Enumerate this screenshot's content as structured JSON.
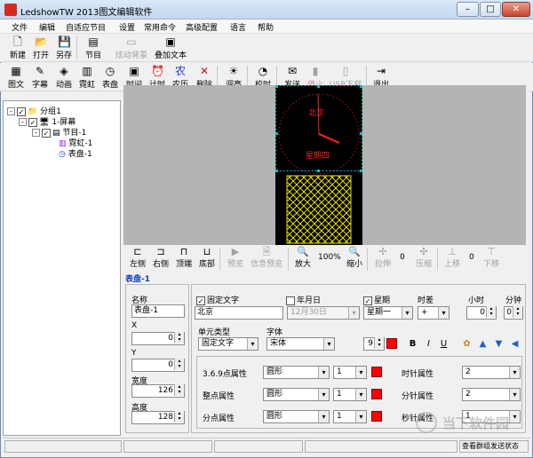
{
  "window": {
    "title": "LedshowTW 2013图文编辑软件",
    "controls": [
      "–",
      "□",
      "✕"
    ]
  },
  "menu": [
    "文件",
    "编辑",
    "自适应节目",
    "设置",
    "常用命令",
    "高级配置",
    "语言",
    "帮助"
  ],
  "toolbar1": [
    {
      "label": "新建",
      "icon": "new-file-icon",
      "glyph": "🗋",
      "enabled": true
    },
    {
      "label": "打开",
      "icon": "open-folder-icon",
      "glyph": "📂",
      "enabled": true
    },
    {
      "label": "另存",
      "icon": "save-icon",
      "glyph": "💾",
      "enabled": true
    },
    {
      "label": "节目",
      "icon": "program-icon",
      "glyph": "▤",
      "enabled": true
    },
    {
      "label": "炫动背景",
      "icon": "dynamic-background-icon",
      "glyph": "▭",
      "enabled": false
    },
    {
      "label": "叠加文本",
      "icon": "overlay-text-icon",
      "glyph": "▣",
      "enabled": true
    }
  ],
  "toolbar2": [
    {
      "label": "图文",
      "icon": "image-text-icon",
      "glyph": "▦",
      "enabled": true
    },
    {
      "label": "字幕",
      "icon": "subtitle-icon",
      "glyph": "✎",
      "enabled": true
    },
    {
      "label": "动画",
      "icon": "animation-icon",
      "glyph": "◈",
      "enabled": true
    },
    {
      "label": "霓虹",
      "icon": "neon-icon",
      "glyph": "▥",
      "enabled": true
    },
    {
      "label": "表盘",
      "icon": "clock-dial-icon",
      "glyph": "◷",
      "enabled": true
    },
    {
      "label": "时间",
      "icon": "time-icon",
      "glyph": "▣",
      "enabled": true
    },
    {
      "label": "计时",
      "icon": "timer-icon",
      "glyph": "⏰",
      "enabled": true
    },
    {
      "label": "农历",
      "icon": "lunar-calendar-icon",
      "glyph": "农",
      "enabled": true
    },
    {
      "label": "删除",
      "icon": "delete-icon",
      "glyph": "✕",
      "enabled": true
    },
    {
      "label": "调亮",
      "icon": "brightness-icon",
      "glyph": "☀",
      "enabled": true
    },
    {
      "label": "校时",
      "icon": "sync-time-icon",
      "glyph": "◔",
      "enabled": true
    },
    {
      "label": "发送",
      "icon": "send-icon",
      "glyph": "✉",
      "enabled": true
    },
    {
      "label": "停止",
      "icon": "stop-icon",
      "glyph": "▮",
      "enabled": false
    },
    {
      "label": "USB下载",
      "icon": "usb-download-icon",
      "glyph": "▯",
      "enabled": false
    },
    {
      "label": "退出",
      "icon": "exit-icon",
      "glyph": "⇥",
      "enabled": true
    }
  ],
  "tree": [
    {
      "label": "分组1",
      "toggle": "-",
      "icon": "folder-icon",
      "glyph": "📁"
    },
    {
      "label": "1-屏幕",
      "toggle": "-",
      "icon": "monitor-icon",
      "glyph": "🖥"
    },
    {
      "label": "节目-1",
      "toggle": "-",
      "icon": "program-icon",
      "glyph": "▤"
    },
    {
      "label": "霓虹-1",
      "toggle": "",
      "icon": "neon-icon",
      "glyph": "▥"
    },
    {
      "label": "表盘-1",
      "toggle": "",
      "icon": "clock-dial-icon",
      "glyph": "◷"
    }
  ],
  "preview": {
    "city": "北京",
    "weekday": "星期四"
  },
  "bottom_toolbar": [
    {
      "label": "左侧",
      "icon": "align-left-icon",
      "glyph": "⊏",
      "enabled": true
    },
    {
      "label": "右侧",
      "icon": "align-right-icon",
      "glyph": "⊐",
      "enabled": true
    },
    {
      "label": "顶端",
      "icon": "align-top-icon",
      "glyph": "⊓",
      "enabled": true
    },
    {
      "label": "底部",
      "icon": "align-bottom-icon",
      "glyph": "⊔",
      "enabled": true
    },
    {
      "label": "预览",
      "icon": "preview-icon",
      "glyph": "▶",
      "enabled": false
    },
    {
      "label": "信息预览",
      "icon": "info-preview-icon",
      "glyph": "🗎",
      "enabled": false
    },
    {
      "label": "放大",
      "icon": "zoom-in-icon",
      "glyph": "🔍",
      "enabled": true
    },
    {
      "label": "缩小",
      "icon": "zoom-out-icon",
      "glyph": "🔍",
      "enabled": true
    },
    {
      "label": "拉伸",
      "icon": "stretch-icon",
      "glyph": "✢",
      "enabled": false
    },
    {
      "label": "压缩",
      "icon": "compress-icon",
      "glyph": "✣",
      "enabled": false
    },
    {
      "label": "上移",
      "icon": "move-up-icon",
      "glyph": "⊥",
      "enabled": false
    },
    {
      "label": "下移",
      "icon": "move-down-icon",
      "glyph": "⊤",
      "enabled": false
    }
  ],
  "zoom": "100%",
  "stretch_value": "0",
  "move_value": "0",
  "props_title": "表盘-1",
  "props": {
    "name_label": "名称",
    "name_value": "表盘-1",
    "x_label": "X",
    "x_value": "0",
    "y_label": "Y",
    "y_value": "0",
    "width_label": "宽度",
    "width_value": "126",
    "height_label": "高度",
    "height_value": "128"
  },
  "text": {
    "fixed_text_label": "固定文字",
    "fixed_text_checked": true,
    "fixed_text_value": "北京",
    "date_label": "年月日",
    "date_checked": false,
    "date_value": "12月30日",
    "week_label": "星期",
    "week_checked": true,
    "week_value": "星期一",
    "timediff_label": "时差",
    "timediff_value": "+",
    "hour_label": "小时",
    "hour_value": "0",
    "minute_label": "分钟",
    "minute_value": "0",
    "unit_type_label": "单元类型",
    "unit_type_value": "固定文字",
    "font_label": "字体",
    "font_value": "宋体",
    "font_size": "9",
    "bold": "B",
    "italic": "I",
    "underline": "U"
  },
  "dial": [
    {
      "label": "3.6.9点属性",
      "shape": "圆形",
      "size": "1"
    },
    {
      "label": "整点属性",
      "shape": "圆形",
      "size": "1"
    },
    {
      "label": "分点属性",
      "shape": "圆形",
      "size": "1"
    }
  ],
  "hands": [
    {
      "label": "时针属性",
      "value": "2"
    },
    {
      "label": "分针属性",
      "value": "2"
    },
    {
      "label": "秒针属性",
      "value": "1"
    }
  ],
  "status": {
    "right": "查看群组发送状态"
  },
  "watermark": "当下软件园",
  "colors": {
    "accent_red": "#ff0000",
    "highlight_yellow": "#e8e000",
    "selection_cyan": "#00c0c0"
  }
}
